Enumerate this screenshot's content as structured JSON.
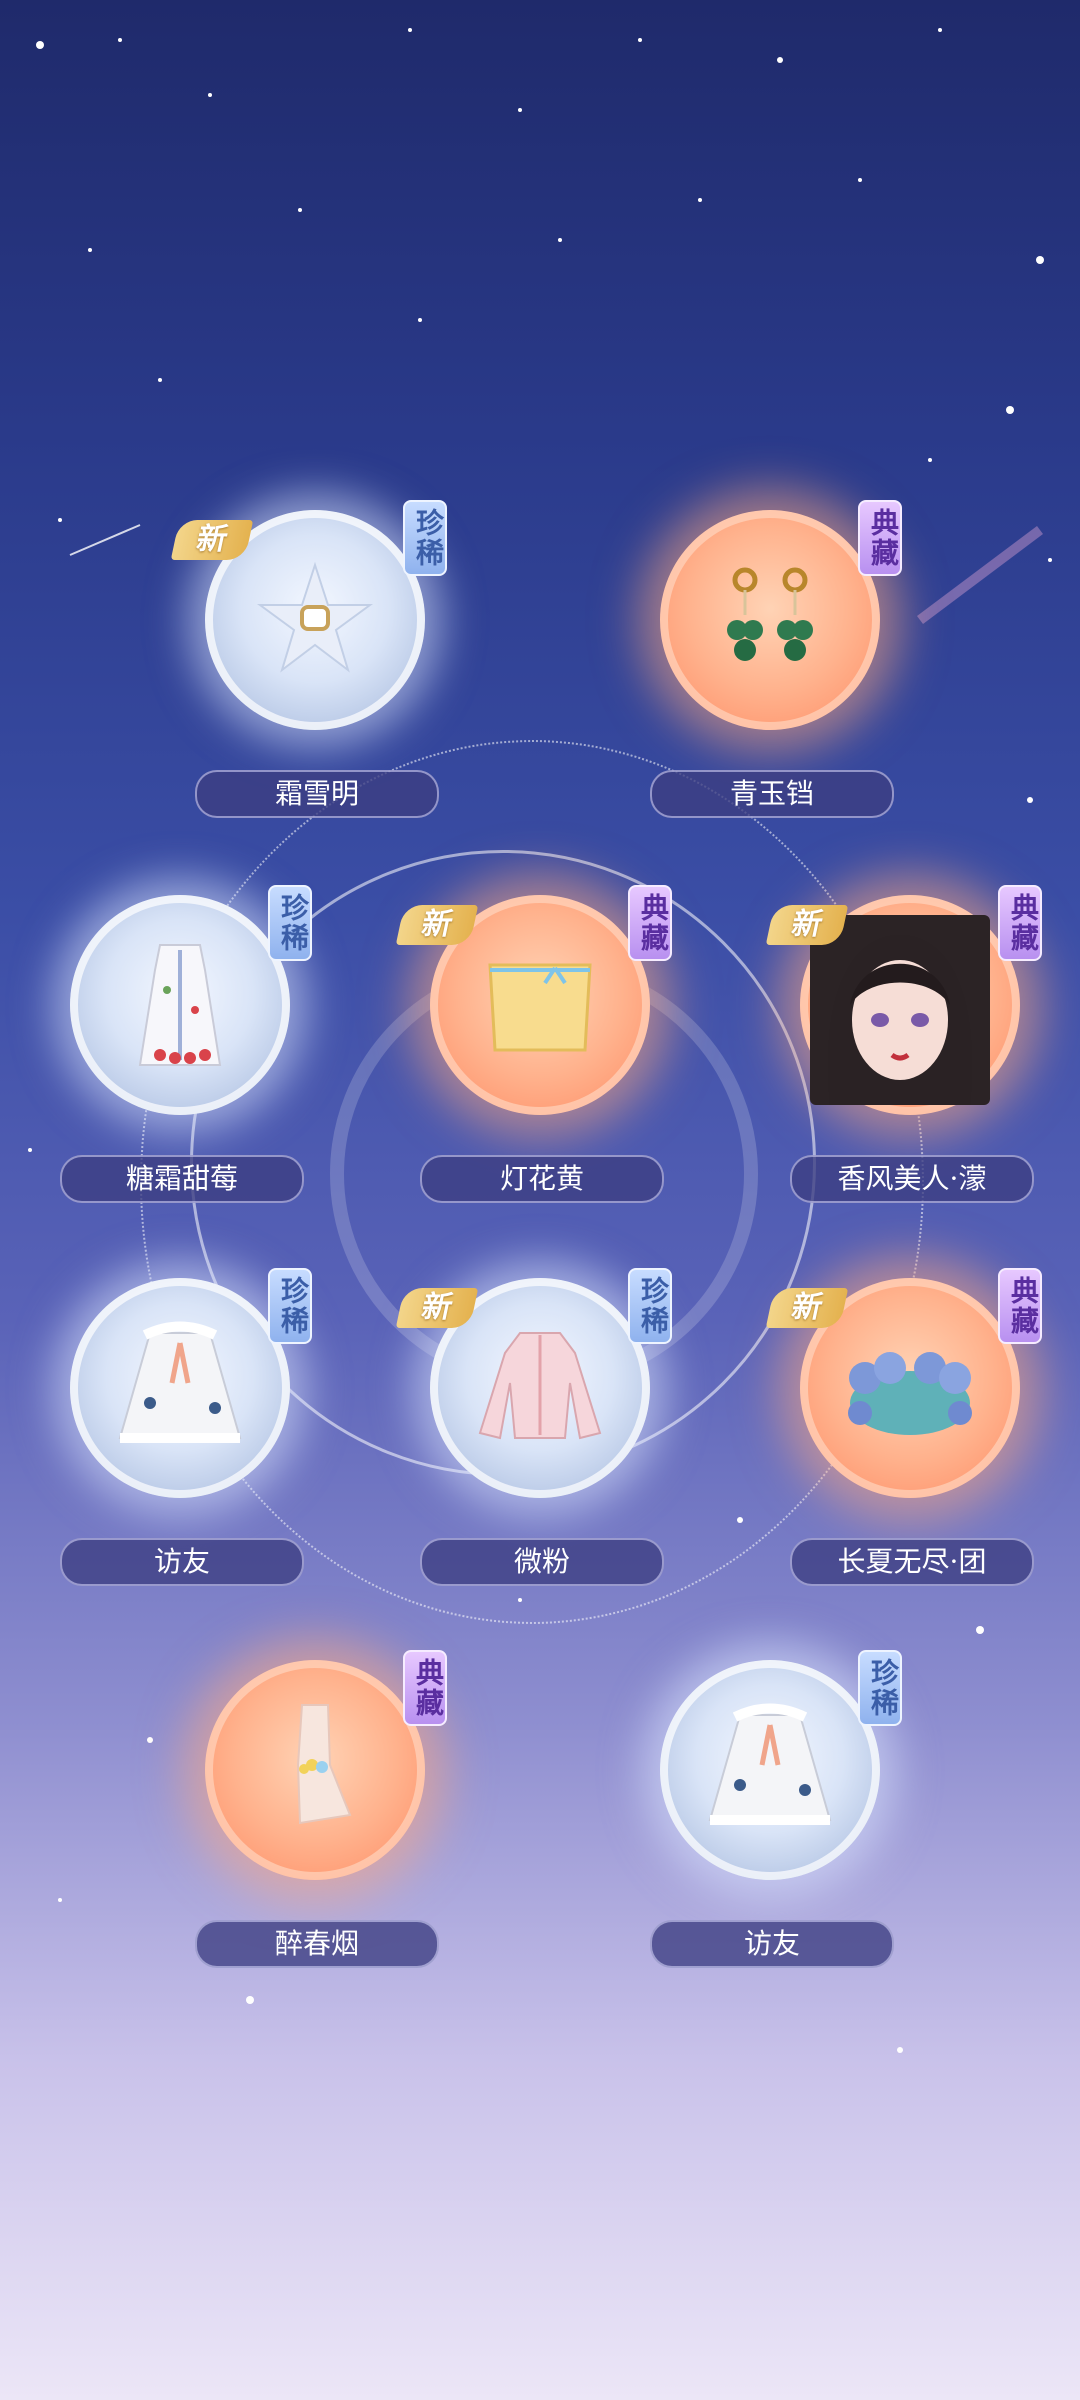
{
  "items": [
    {
      "name": "霜雪明",
      "rarity": "珍稀",
      "new": "新",
      "icon": "ring-icon"
    },
    {
      "name": "青玉铛",
      "rarity": "典藏",
      "new": "",
      "icon": "earrings-icon"
    },
    {
      "name": "糖霜甜莓",
      "rarity": "珍稀",
      "new": "",
      "icon": "dress-icon"
    },
    {
      "name": "灯花黄",
      "rarity": "典藏",
      "new": "新",
      "icon": "skirt-icon"
    },
    {
      "name": "香风美人·濛",
      "rarity": "典藏",
      "new": "新",
      "icon": "portrait-icon"
    },
    {
      "name": "访友",
      "rarity": "珍稀",
      "new": "",
      "icon": "cape-icon"
    },
    {
      "name": "微粉",
      "rarity": "珍稀",
      "new": "新",
      "icon": "top-icon"
    },
    {
      "name": "长夏无尽·团",
      "rarity": "典藏",
      "new": "新",
      "icon": "pond-icon"
    },
    {
      "name": "醉春烟",
      "rarity": "典藏",
      "new": "",
      "icon": "anklet-icon"
    },
    {
      "name": "访友",
      "rarity": "珍稀",
      "new": "",
      "icon": "cape-icon"
    }
  ]
}
